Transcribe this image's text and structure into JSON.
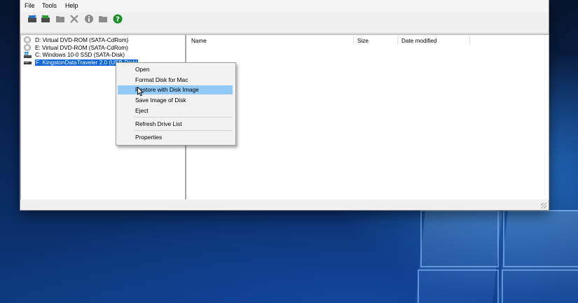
{
  "menubar": {
    "items": [
      "File",
      "Tools",
      "Help"
    ]
  },
  "toolbar": {
    "buttons": [
      "write-image-icon",
      "save-image-icon",
      "folder-icon",
      "delete-icon",
      "info-icon",
      "folder-icon",
      "help-icon"
    ],
    "accent": "#1a8f2a"
  },
  "tree": {
    "items": [
      {
        "label": "D: Virtual DVD-ROM (SATA-CdRom)",
        "icon": "dvd-icon"
      },
      {
        "label": "E: Virtual DVD-ROM (SATA-CdRom)",
        "icon": "dvd-icon"
      },
      {
        "label": "C: Windows 10-0 SSD (SATA-Disk)",
        "icon": "windows-disk-icon"
      },
      {
        "label": "F: KingstonDataTraveler 2.0 (USB-Disk)",
        "icon": "usb-drive-icon",
        "selected": true
      }
    ],
    "selection_color": "#0a64d8"
  },
  "list": {
    "columns": [
      "Name",
      "Size",
      "Date modified"
    ]
  },
  "context_menu": {
    "items": [
      "Open",
      "Format Disk for Mac",
      "Restore with Disk Image",
      "Save Image of Disk",
      "Eject",
      "Refresh Drive List",
      "Properties"
    ],
    "highlighted": "Restore with Disk Image",
    "highlight_color": "#91c9f7"
  }
}
